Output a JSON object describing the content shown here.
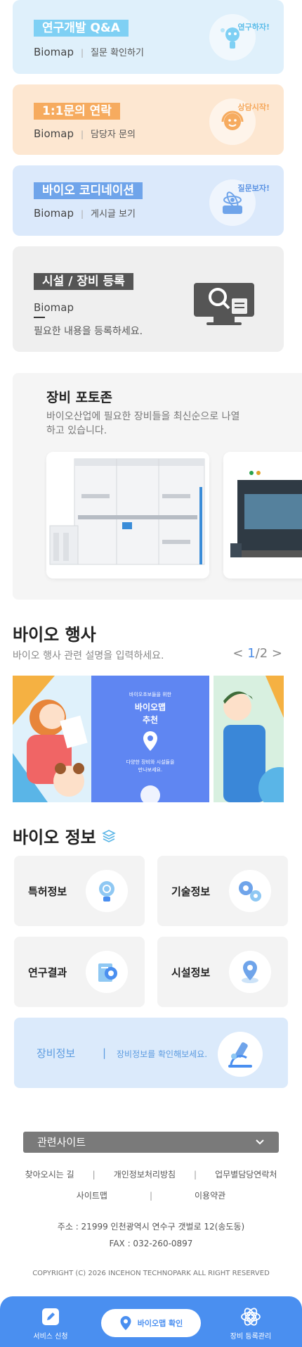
{
  "services": {
    "qa": {
      "title": "연구개발 Q&A",
      "brand": "Biomap",
      "desc": "질문 확인하기",
      "tag": "연구하자!"
    },
    "contact": {
      "title": "1:1문의 연락",
      "brand": "Biomap",
      "desc": "담당자 문의",
      "tag": "상담시작!"
    },
    "coord": {
      "title": "바이오 코디네이션",
      "brand": "Biomap",
      "desc": "게시글 보기",
      "tag": "질문보자!"
    },
    "facility": {
      "title": "시설 / 장비 등록",
      "brand": "Biomap",
      "desc": "필요한 내용을 등록하세요."
    }
  },
  "photozone": {
    "title": "장비 포토존",
    "desc": "바이오산업에 필요한 장비들을 최신순으로 나열하고 있습니다."
  },
  "events": {
    "title": "바이오 행사",
    "desc": "바이오 행사 관련 설명을 입력하세요.",
    "pager_prev": "<",
    "pager_current": "1",
    "pager_sep": "/",
    "pager_total": "2",
    "pager_next": ">",
    "banner": {
      "small": "바이오초보들을 위한",
      "title_line1": "바이오맵",
      "title_line2": "추천",
      "desc_line1": "다양한 장비와 시설들을",
      "desc_line2": "만나보세요."
    }
  },
  "info": {
    "title": "바이오 정보",
    "cards": {
      "patent": "특허정보",
      "tech": "기술정보",
      "research": "연구결과",
      "facility": "시설정보"
    },
    "equip": {
      "label": "장비정보",
      "bar": "|",
      "desc": "장비정보를 확인해보세요."
    }
  },
  "footer": {
    "related": "관련사이트",
    "links_row1": [
      "찾아오시는 길",
      "개인정보처리방침",
      "업무별담당연락처"
    ],
    "links_row2": [
      "사이트맵",
      "이용약관"
    ],
    "address": "주소 : 21999 인천광역시 연수구 갯벌로 12(송도동)",
    "fax": "FAX : 032-260-0897",
    "copyright": "COPYRIGHT (C) 2026 INCEHON TECHNOPARK ALL RIGHT RESERVED"
  },
  "bottom_nav": {
    "apply": "서비스 신청",
    "center": "바이오맵 확인",
    "equip": "장비 등록관리"
  },
  "colors": {
    "primary": "#4a8ff0",
    "qa_accent": "#7fd0f4",
    "contact_accent": "#f6ab5f",
    "coord_accent": "#6fa4ea"
  }
}
